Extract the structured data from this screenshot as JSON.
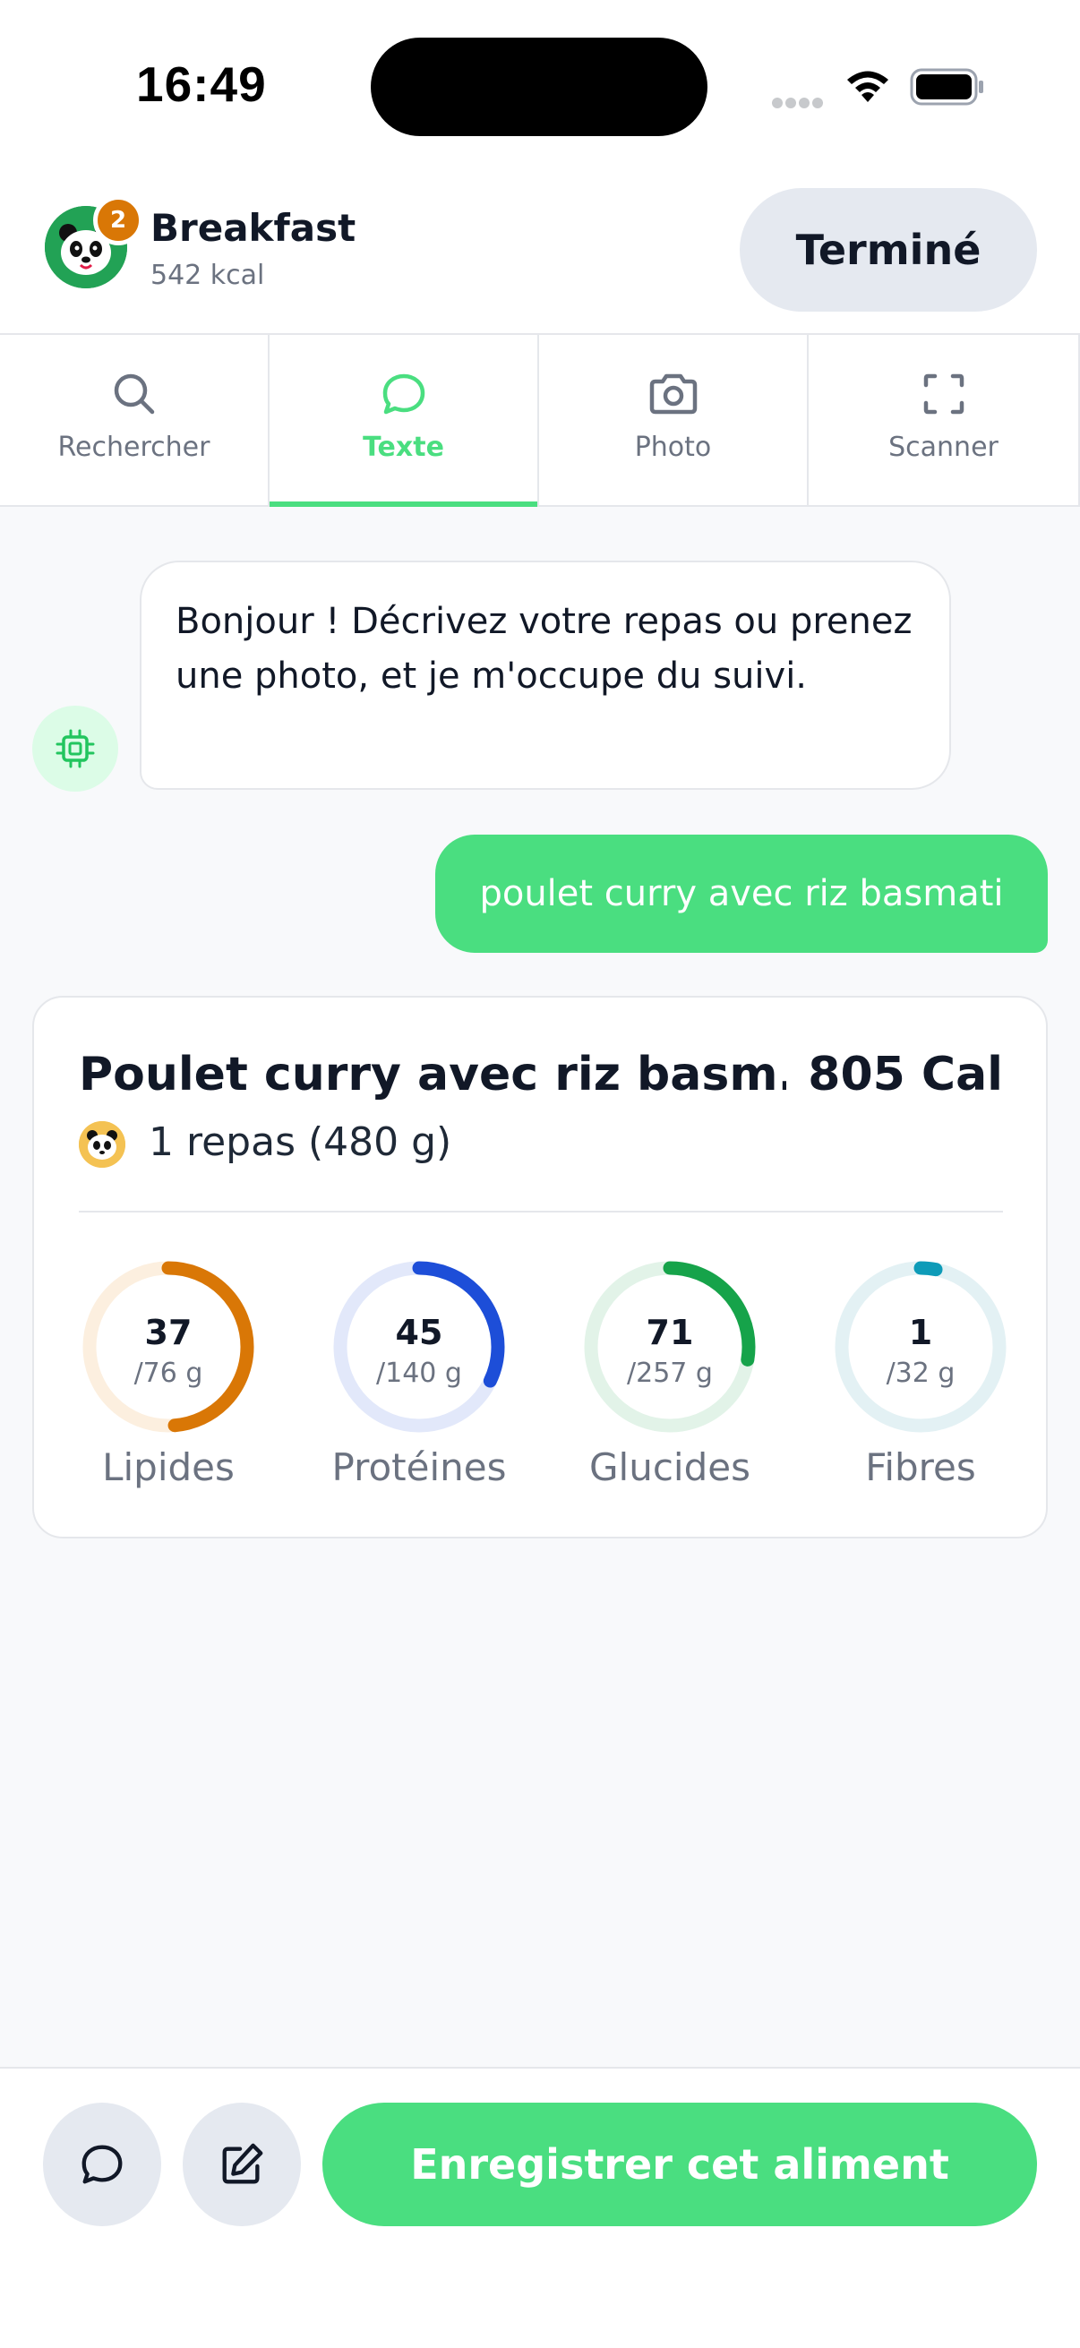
{
  "status_bar": {
    "time": "16:49"
  },
  "header": {
    "badge_count": "2",
    "meal_title": "Breakfast",
    "meal_kcal": "542 kcal",
    "done_label": "Terminé"
  },
  "tabs": [
    {
      "label": "Rechercher",
      "icon": "search-icon",
      "active": false
    },
    {
      "label": "Texte",
      "icon": "chat-bubble-icon",
      "active": true
    },
    {
      "label": "Photo",
      "icon": "camera-icon",
      "active": false
    },
    {
      "label": "Scanner",
      "icon": "scan-frame-icon",
      "active": false
    }
  ],
  "chat": {
    "bot_message": "Bonjour ! Décrivez votre repas ou prenez une photo, et je m'occupe du suivi.",
    "user_message": "poulet curry avec riz basmati"
  },
  "food_card": {
    "name": "Poulet curry avec riz basm...",
    "calories": "805 Cal",
    "portion": "1 repas (480 g)",
    "macros": [
      {
        "name": "Lipides",
        "value": "37",
        "target": "/76 g",
        "fraction": 0.487,
        "color": "#d97706",
        "track": "#fcefdf"
      },
      {
        "name": "Protéines",
        "value": "45",
        "target": "/140 g",
        "fraction": 0.321,
        "color": "#1d4ed8",
        "track": "#e2e8fa"
      },
      {
        "name": "Glucides",
        "value": "71",
        "target": "/257 g",
        "fraction": 0.276,
        "color": "#16a34a",
        "track": "#e2f3e8"
      },
      {
        "name": "Fibres",
        "value": "1",
        "target": "/32 g",
        "fraction": 0.031,
        "color": "#0e9bb8",
        "track": "#e3f1f4"
      }
    ]
  },
  "bottom_bar": {
    "save_label": "Enregistrer cet aliment"
  },
  "colors": {
    "accent": "#4ade80",
    "badge": "#d97706"
  }
}
